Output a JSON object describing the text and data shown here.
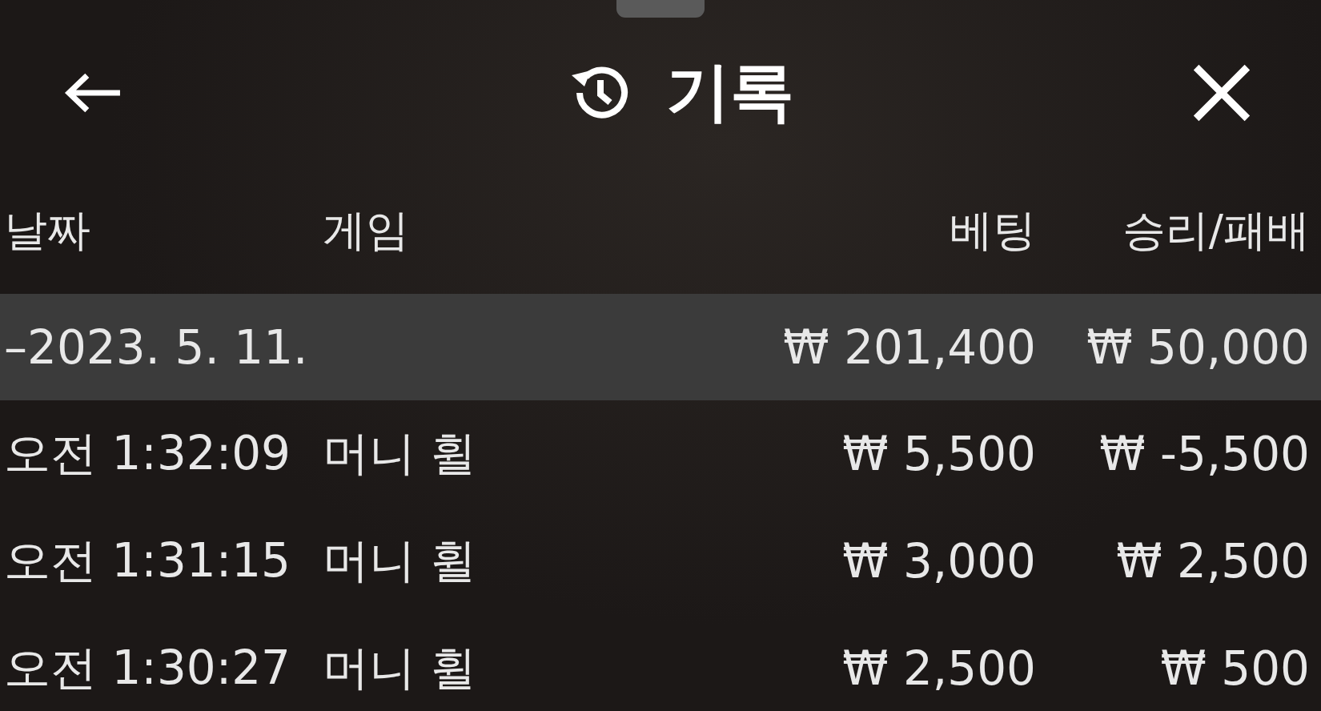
{
  "header": {
    "title": "기록"
  },
  "columns": [
    "날짜",
    "게임",
    "베팅",
    "승리/패배"
  ],
  "groups": [
    {
      "date": "–2023. 5. 11.",
      "bet": "₩ 201,400",
      "result": "₩ 50,000",
      "rows": [
        {
          "time": "오전 1:32:09",
          "game": "머니 휠",
          "bet": "₩ 5,500",
          "result": "₩ -5,500"
        },
        {
          "time": "오전 1:31:15",
          "game": "머니 휠",
          "bet": "₩ 3,000",
          "result": "₩ 2,500"
        },
        {
          "time": "오전 1:30:27",
          "game": "머니 휠",
          "bet": "₩ 2,500",
          "result": "₩ 500"
        }
      ]
    }
  ]
}
